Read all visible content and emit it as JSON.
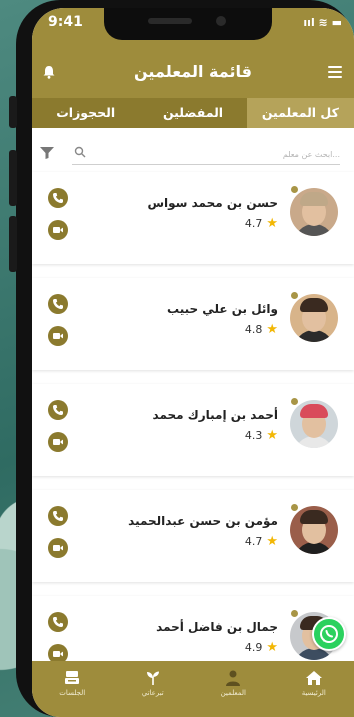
{
  "status_bar": {
    "time": "9:41",
    "icons": "ııl ≋ ▬"
  },
  "header": {
    "title": "قائمة المعلمين"
  },
  "tabs": [
    {
      "label": "كل المعلمين",
      "active": true
    },
    {
      "label": "المفضلين",
      "active": false
    },
    {
      "label": "الحجوزات",
      "active": false
    }
  ],
  "search": {
    "placeholder": "ابحث عن معلم..."
  },
  "teachers": [
    {
      "name": "حسن بن محمد سواس",
      "rating": "4.7"
    },
    {
      "name": "وائل بن علي حبيب",
      "rating": "4.8"
    },
    {
      "name": "أحمد بن إمبارك محمد",
      "rating": "4.3"
    },
    {
      "name": "مؤمن بن حسن عبدالحميد",
      "rating": "4.7"
    },
    {
      "name": "جمال بن فاضل أحمد",
      "rating": "4.9"
    }
  ],
  "bottom_nav": [
    {
      "label": "الرئيسية",
      "icon": "home-icon"
    },
    {
      "label": "المعلمين",
      "icon": "teacher-icon"
    },
    {
      "label": "تبرعاتي",
      "icon": "donation-icon"
    },
    {
      "label": "الجلسات",
      "icon": "sessions-icon"
    }
  ],
  "colors": {
    "primary": "#9e8c3c",
    "tab_bar": "#8b7a2e",
    "active_tab": "#b5a35a",
    "star": "#f2b705",
    "whatsapp": "#2bd15e"
  }
}
